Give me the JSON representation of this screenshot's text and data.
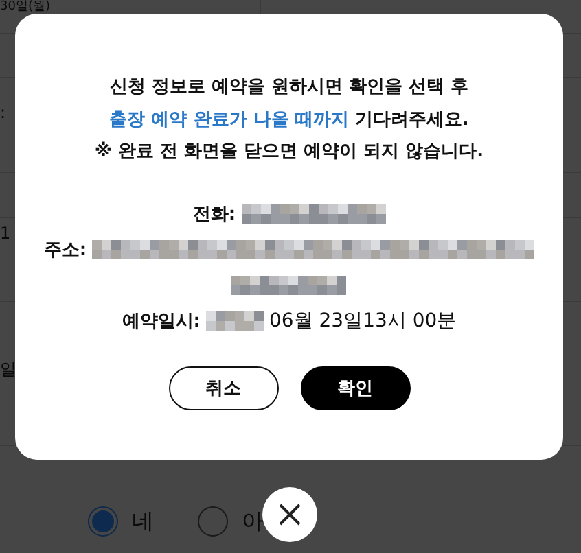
{
  "background": {
    "date_text": "30일(월)",
    "fragments": [
      ":",
      "1",
      "일"
    ],
    "radios": [
      {
        "label": "네",
        "selected": true
      },
      {
        "label": "아",
        "selected": false
      }
    ]
  },
  "dialog": {
    "message": [
      {
        "text": "신청 정보로 예약을 원하시면 확인을 선택 후"
      },
      {
        "highlight": "출장 예약 완료가 나올 때까지",
        "text": " 기다려주세요."
      },
      {
        "text": "※ 완료 전 화면을 닫으면 예약이 되지 않습니다."
      }
    ],
    "details": [
      {
        "label": "전화:"
      },
      {
        "label": "주소:"
      },
      {
        "label": "예약일시:",
        "value": "06월 23일13시 00분"
      }
    ],
    "buttons": [
      {
        "label": "취소",
        "kind": "secondary"
      },
      {
        "label": "확인",
        "kind": "primary"
      }
    ]
  }
}
